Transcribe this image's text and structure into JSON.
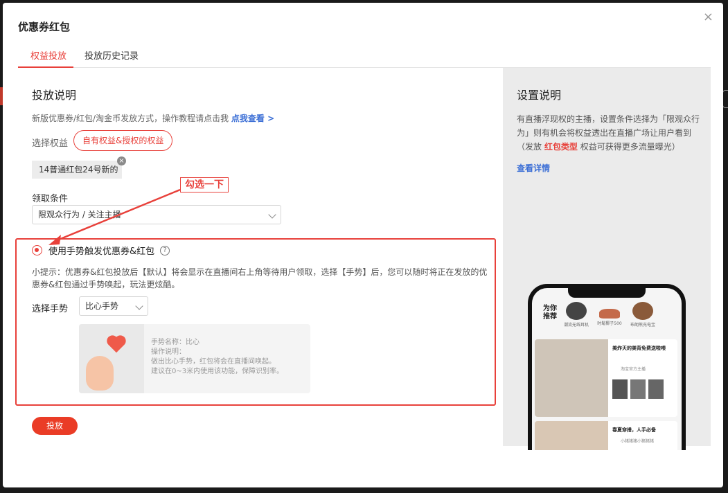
{
  "modal": {
    "title": "优惠券红包",
    "close": "×"
  },
  "tabs": [
    {
      "label": "权益投放",
      "active": true
    },
    {
      "label": "投放历史记录",
      "active": false
    }
  ],
  "left": {
    "section_title": "投放说明",
    "desc": "新版优惠券/红包/淘金币发放方式，操作教程请点击我",
    "desc_link": "点我查看 >",
    "choose_rights_label": "选择权益",
    "rights_pill": "自有权益&授权的权益",
    "coupon_tag": "14普通红包24号新的",
    "condition_label": "领取条件",
    "condition_value": "限观众行为 / 关注主播",
    "gesture_option_label": "使用手势触发优惠券&红包",
    "help": "?",
    "tip": "小提示：优惠券&红包投放后【默认】将会显示在直播间右上角等待用户领取，选择【手势】后，您可以随时将正在发放的优惠券&红包通过手势唤起，玩法更炫酷。",
    "gesture_label": "选择手势",
    "gesture_value": "比心手势",
    "gesture_info": {
      "name": "手势名称：比心",
      "op": "操作说明：",
      "line1": "做出比心手势，红包将会在直播间唤起。",
      "line2": "建议在0~3米内使用该功能，保障识别率。"
    },
    "submit": "投放",
    "annotation": "勾选一下"
  },
  "right": {
    "title": "设置说明",
    "desc_pre": "有直播浮现权的主播，设置条件选择为「限观众行为」则有机会将权益透出在直播广场让用户看到（发放",
    "desc_bold": "红包类型",
    "desc_post": "权益可获得更多流量曝光）",
    "link": "查看详情",
    "phone": {
      "rec": "为你推荐",
      "products": [
        "潮流无线耳机",
        "时髦椰子500",
        "布朗熊充电宝"
      ],
      "card1_title": "美炸天的美背免费送啦喂",
      "card1_shop": "淘宝官方主播",
      "card2_title": "春夏穿搭，人手必备",
      "card2_shop": "小猪猪猪小猪猪猪"
    }
  },
  "colors": {
    "accent": "#e8403a",
    "link": "#3c6fd6",
    "submit": "#ea3c26"
  }
}
